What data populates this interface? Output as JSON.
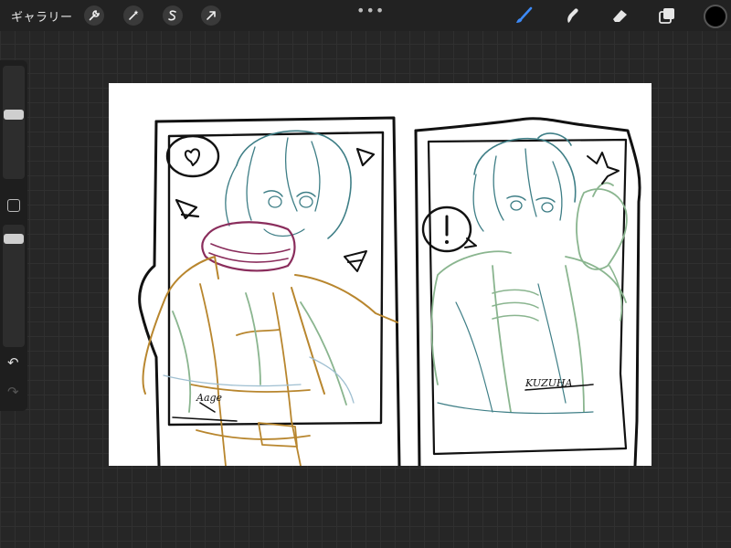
{
  "topbar": {
    "gallery_label": "ギャラリー",
    "more_label": "•••"
  },
  "left_tools": [
    "wrench-icon",
    "magic-wand-icon",
    "selection-icon",
    "transform-arrow-icon"
  ],
  "right_tools": [
    "brush-icon",
    "smudge-icon",
    "eraser-icon",
    "layers-icon"
  ],
  "colors": {
    "accent": "#3d8af7",
    "current_color": "#000000",
    "lineart": "#111111",
    "sketch_teal": "#3e7e86",
    "sketch_green": "#8ab58f",
    "sketch_orange": "#b8862e",
    "sketch_purple": "#8a2d5c",
    "sketch_blue": "#9fbfd1"
  },
  "canvas": {
    "signature_left": "Aage",
    "signature_right": "KUZUHA"
  }
}
